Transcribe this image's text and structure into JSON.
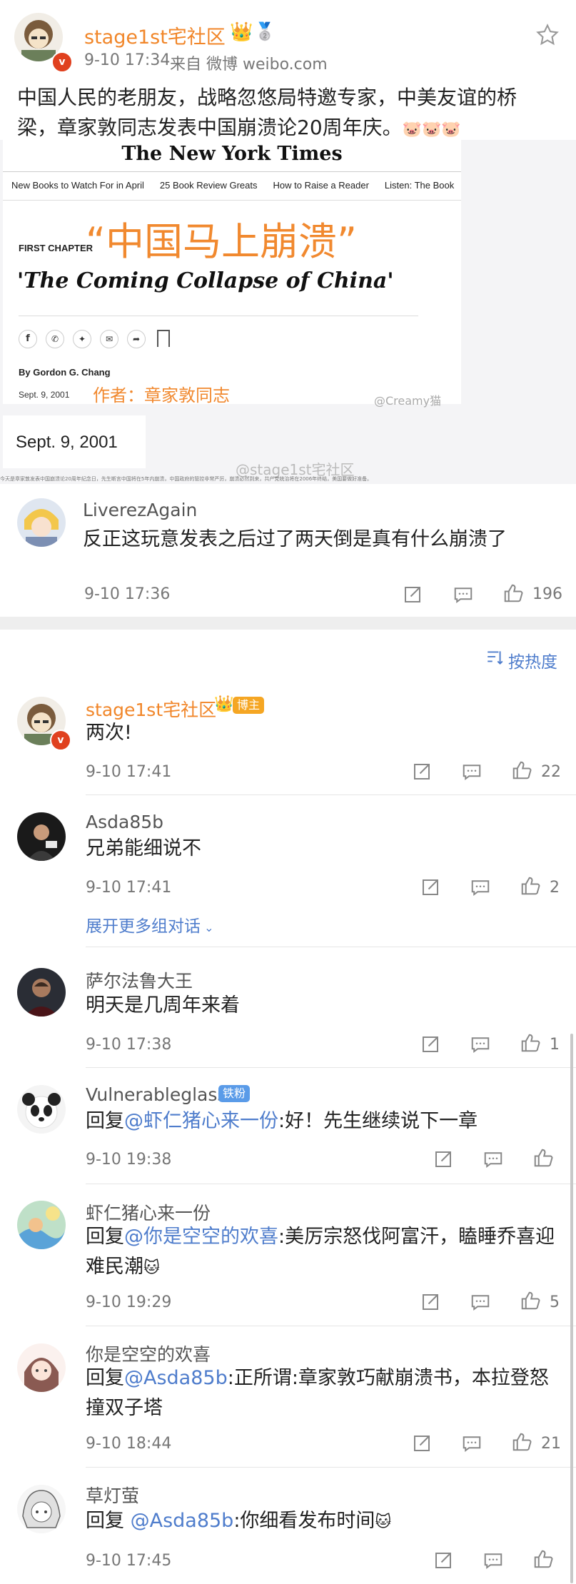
{
  "post": {
    "author": "stage1st宅社区",
    "time": "9-10 17:34",
    "source": "来自 微博 weibo.com",
    "text": "中国人民的老朋友，战略忽悠局特邀专家，中美友谊的桥梁，章家敦同志发表中国崩溃论20周年庆。",
    "emojis": "🐷🐷🐷",
    "image": {
      "masthead": "The New York Times",
      "nav": [
        "New Books to Watch For in April",
        "25 Book Review Greats",
        "How to Raise a Reader",
        "Listen: The Book"
      ],
      "overlay_title": "“中国马上崩溃”",
      "kicker": "FIRST CHAPTER",
      "headline": "'The Coming Collapse of China'",
      "byline": "By Gordon G. Chang",
      "date_small": "Sept. 9, 2001",
      "overlay_author": "作者：章家敦同志",
      "watermark1": "@Creamy猫",
      "date_big": "Sept. 9, 2001",
      "watermark2": "@stage1st宅社区",
      "fine_print": "今天是章家敦发表中国崩溃论20周年纪念日，先生断言中国将在5年内崩溃，中国政府的管控非常严厉，崩溃必然到来，共产党统治将在2006年终结，美国要做好准备。"
    }
  },
  "top_comment": {
    "author": "LiverezAgain",
    "text": "反正这玩意发表之后过了两天倒是真有什么崩溃了",
    "time": "9-10 17:36",
    "likes": "196"
  },
  "sort_label": "按热度",
  "replies": [
    {
      "author": "stage1st宅社区",
      "badge": "博主",
      "text": "两次!",
      "time": "9-10 17:41",
      "likes": "22"
    },
    {
      "author": "Asda85b",
      "text": "兄弟能细说不",
      "time": "9-10 17:41",
      "likes": "2",
      "expand": "展开更多组对话"
    },
    {
      "author": "萨尔法鲁大王",
      "text": "明天是几周年来着",
      "time": "9-10 17:38",
      "likes": "1"
    },
    {
      "author": "Vulnerableglass",
      "badge": "铁粉",
      "reply_prefix": "回复",
      "mention": "@虾仁猪心来一份",
      "text": ":好！先生继续说下一章",
      "time": "9-10 19:38",
      "likes": ""
    },
    {
      "author": "虾仁猪心来一份",
      "reply_prefix": "回复",
      "mention": "@你是空空的欢喜",
      "text": ":美厉宗怒伐阿富汗，瞌睡乔喜迎难民潮",
      "emoji": "🐱",
      "time": "9-10 19:29",
      "likes": "5"
    },
    {
      "author": "你是空空的欢喜",
      "reply_prefix": "回复",
      "mention": "@Asda85b",
      "text": ":正所谓:章家敦巧献崩溃书，本拉登怒撞双子塔",
      "time": "9-10 18:44",
      "likes": "21"
    },
    {
      "author": "草灯萤",
      "reply_prefix": "回复 ",
      "mention": "@Asda85b",
      "text": ":你细看发布时间",
      "emoji": "🐱",
      "time": "9-10 17:45",
      "likes": ""
    }
  ],
  "colors": {
    "orange": "#f18629",
    "link": "#4f7dcc",
    "vip_badge": "#f5a623",
    "fan_badge": "#5a9be8"
  }
}
